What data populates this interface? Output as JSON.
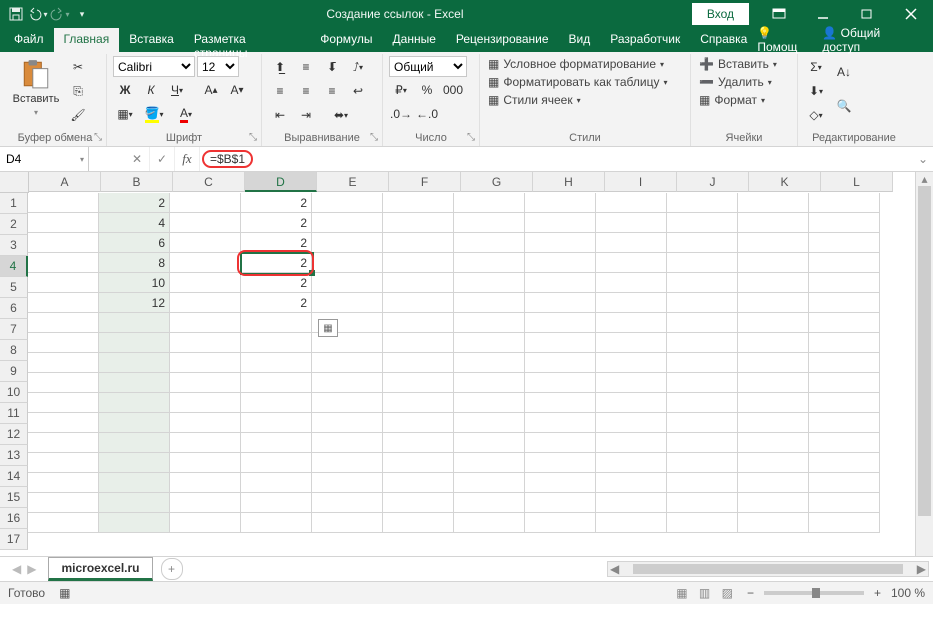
{
  "title": "Создание ссылок  -  Excel",
  "signin": "Вход",
  "tabs": {
    "file": "Файл",
    "home": "Главная",
    "insert": "Вставка",
    "layout": "Разметка страницы",
    "formulas": "Формулы",
    "data": "Данные",
    "review": "Рецензирование",
    "view": "Вид",
    "dev": "Разработчик",
    "help": "Справка",
    "tell": "Помощ",
    "share": "Общий доступ"
  },
  "groups": {
    "clipboard": "Буфер обмена",
    "font": "Шрифт",
    "align": "Выравнивание",
    "number": "Число",
    "styles": "Стили",
    "cells": "Ячейки",
    "editing": "Редактирование"
  },
  "font": {
    "name": "Calibri",
    "size": "12"
  },
  "paste": "Вставить",
  "numberFormat": "Общий",
  "styles": {
    "cond": "Условное форматирование",
    "table": "Форматировать как таблицу",
    "cell": "Стили ячеек"
  },
  "cells": {
    "insert": "Вставить",
    "delete": "Удалить",
    "format": "Формат"
  },
  "namebox": "D4",
  "formula": "=$B$1",
  "cols": [
    "A",
    "B",
    "C",
    "D",
    "E",
    "F",
    "G",
    "H",
    "I",
    "J",
    "K",
    "L"
  ],
  "rows": [
    "1",
    "2",
    "3",
    "4",
    "5",
    "6",
    "7",
    "8",
    "9",
    "10",
    "11",
    "12",
    "13",
    "14",
    "15",
    "16",
    "17"
  ],
  "dataB": [
    "2",
    "4",
    "6",
    "8",
    "10",
    "12"
  ],
  "dataD": [
    "2",
    "2",
    "2",
    "2",
    "2",
    "2"
  ],
  "activeCol": 3,
  "activeRow": 3,
  "sheet": "microexcel.ru",
  "status": "Готово",
  "zoom": "100 %"
}
